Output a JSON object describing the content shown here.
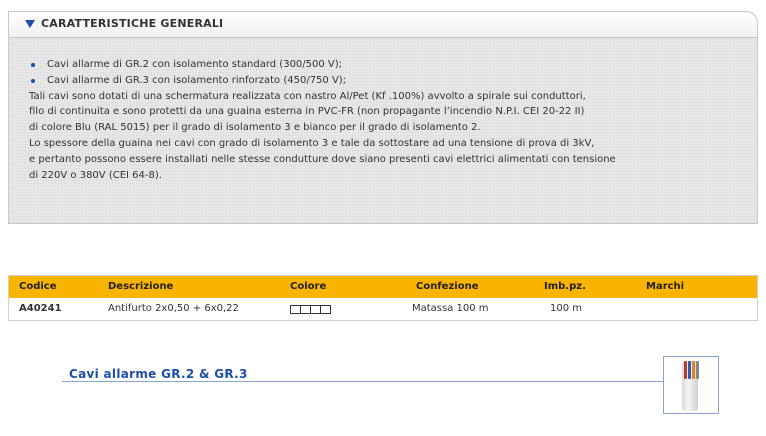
{
  "section": {
    "title": "CARATTERISTICHE GENERALI",
    "bullets": [
      "Cavi allarme di GR.2 con isolamento standard (300/500 V);",
      "Cavi allarme di GR.3 con isolamento rinforzato (450/750 V);"
    ],
    "paragraph": [
      "Tali cavi sono dotati di una schermatura realizzata con nastro Al/Pet (Kf .100%) avvolto a spirale sui conduttori,",
      "filo di continuita e sono protetti da una guaina esterna in PVC-FR (non propagante l’incendio N.P.I. CEI 20-22 II)",
      "di colore Blu (RAL 5015) per il grado di isolamento 3 e bianco per il grado di isolamento 2.",
      "Lo spessore della guaina nei cavi con grado di isolamento 3 e tale da sottostare ad una tensione di prova di 3kV,",
      "e pertanto possono essere installati nelle stesse condutture dove siano presenti cavi elettrici alimentati con tensione",
      "di 220V o 380V (CEI 64-8)."
    ],
    "accent_color": "#1e4fa6"
  },
  "table": {
    "header_color": "#f9b400",
    "columns": [
      "Codice",
      "Descrizione",
      "Colore",
      "Confezione",
      "Imb.pz.",
      "Marchi"
    ],
    "rows": [
      {
        "codice": "A40241",
        "descrizione": "Antifurto 2x0,50 + 6x0,22",
        "colore_swatches": [
          "#ffffff",
          "#ffffff",
          "#ffffff",
          "#ffffff"
        ],
        "confezione": "Matassa 100 m",
        "imb": "100 m",
        "marchi": ""
      }
    ]
  },
  "product": {
    "link_label": "Cavi allarme GR.2 & GR.3",
    "thumbnail_icon": "cable-image"
  }
}
